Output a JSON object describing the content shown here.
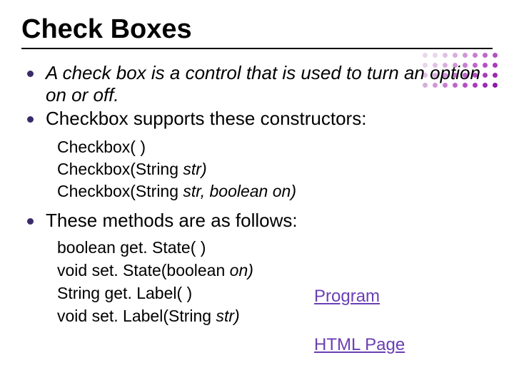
{
  "title": "Check Boxes",
  "bullets": {
    "b1": "A check box is a control that is used to turn an option on or off.",
    "b2": "Checkbox supports these constructors:",
    "b3": "These methods are as follows:"
  },
  "constructors": {
    "c1_full": "Checkbox( )",
    "c2_prefix": "Checkbox(String ",
    "c2_arg": "str)",
    "c3_prefix": "Checkbox(String ",
    "c3_args": "str, boolean on)"
  },
  "methods": {
    "m1": "boolean get. State( )",
    "m2_prefix": "void set. State(boolean ",
    "m2_arg": "on)",
    "m3": "String get. Label( )",
    "m4_prefix": "void set. Label(String ",
    "m4_arg": "str)"
  },
  "links": {
    "program": "Program",
    "html_page": "HTML Page"
  },
  "dot_colors": [
    "#e8d6ea",
    "#e8d6ea",
    "#e0c1e4",
    "#d8aede",
    "#cf97d7",
    "#c67fcf",
    "#bd67c8",
    "#b351c1",
    "#e8d6ea",
    "#e0c1e4",
    "#d8aede",
    "#cf97d7",
    "#c67fcf",
    "#bd67c8",
    "#b351c1",
    "#a93bba",
    "#e0c1e4",
    "#d8aede",
    "#cf97d7",
    "#c67fcf",
    "#bd67c8",
    "#b351c1",
    "#a93bba",
    "#9d28b1",
    "#d8aede",
    "#cf97d7",
    "#c67fcf",
    "#bd67c8",
    "#b351c1",
    "#a93bba",
    "#9d28b1",
    "#8f1aa6"
  ]
}
